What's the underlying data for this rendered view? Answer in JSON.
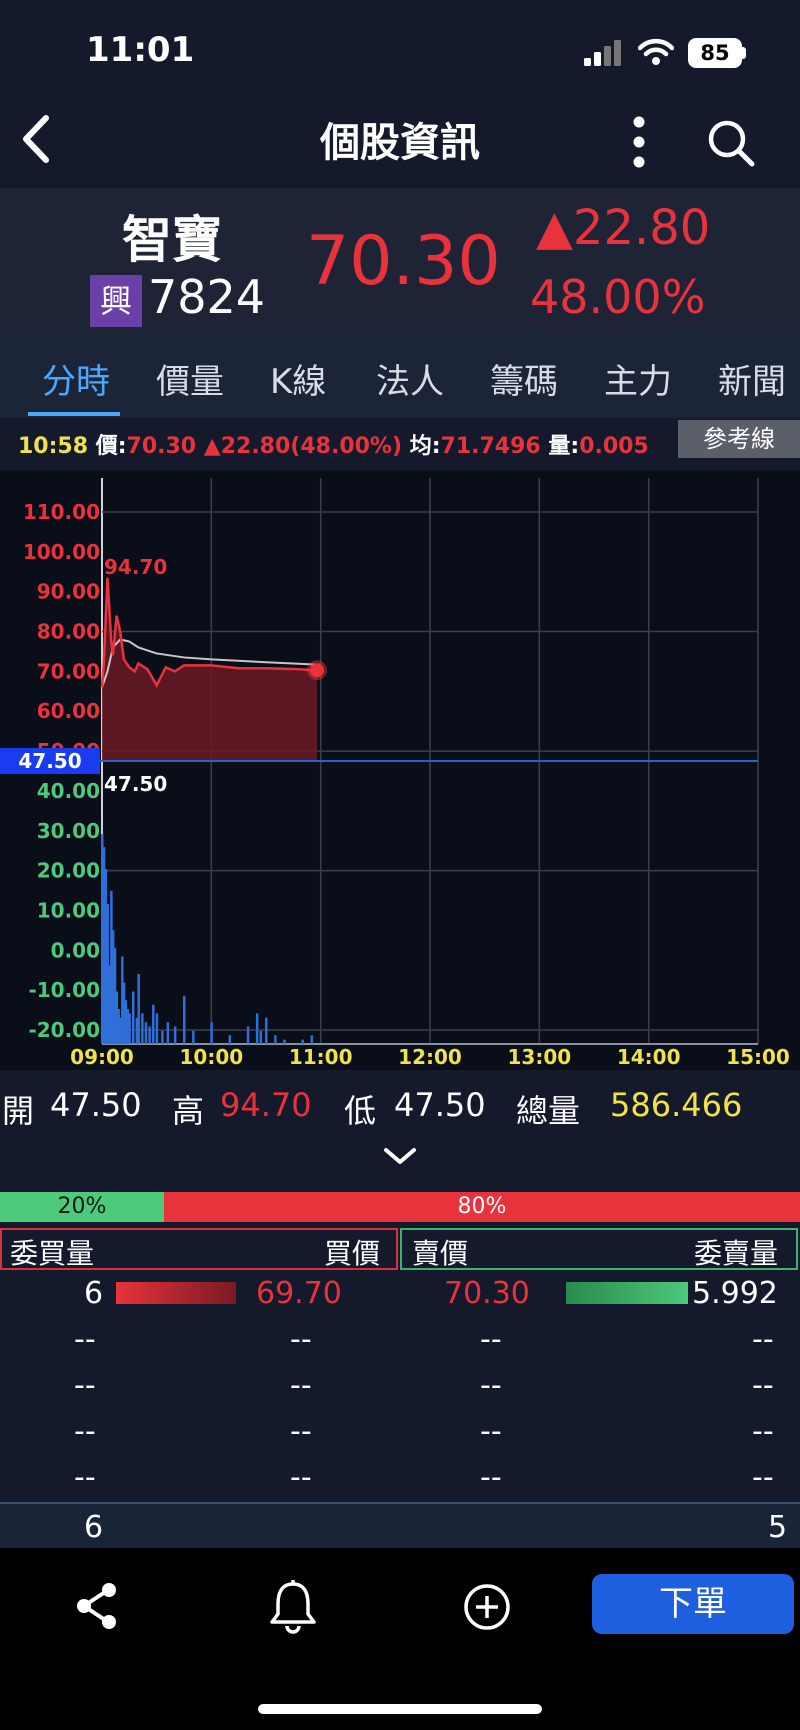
{
  "status_bar": {
    "time": "11:01",
    "battery": "85"
  },
  "header": {
    "title": "個股資訊"
  },
  "stock": {
    "name": "智寶",
    "industry_badge": "興",
    "code": "7824",
    "price": "70.30",
    "change": "▲22.80",
    "change_percent": "48.00%"
  },
  "tabs": [
    "分時",
    "價量",
    "K線",
    "法人",
    "籌碼",
    "主力",
    "新聞"
  ],
  "info": {
    "time": "10:58",
    "price_label": "價:",
    "price": "70.30",
    "change": "▲22.80(48.00%)",
    "avg_label": "均:",
    "avg": "71.7496",
    "vol_label": "量:",
    "vol": "0.005",
    "ref_line_button": "參考線"
  },
  "colors": {
    "up": "#e8323c",
    "down": "#4cc97a",
    "accent": "#4aa8ff",
    "volume": "#2f6fd8",
    "reference": "#2a5fd0"
  },
  "chart_data": {
    "type": "line",
    "price_axis_ticks": [
      "110.00",
      "100.00",
      "90.00",
      "80.00",
      "70.00",
      "60.00",
      "50.00",
      "40.00",
      "30.00",
      "20.00",
      "10.00",
      "0.00",
      "-10.00",
      "-20.00"
    ],
    "x_ticks": [
      "09:00",
      "10:00",
      "11:00",
      "12:00",
      "13:00",
      "14:00",
      "15:00"
    ],
    "reference_price": "47.50",
    "high_label": "94.70",
    "low_label": "47.50",
    "ylim": [
      -20,
      110
    ],
    "grid": true,
    "series": [
      {
        "kind": "price",
        "x": [
          "09:00",
          "09:01",
          "09:03",
          "09:05",
          "09:06",
          "09:08",
          "09:10",
          "09:12",
          "09:15",
          "09:18",
          "09:20",
          "09:25",
          "09:30",
          "09:35",
          "09:40",
          "09:45",
          "09:50",
          "10:00",
          "10:15",
          "10:30",
          "10:45",
          "10:58"
        ],
        "values": [
          66,
          72,
          93.5,
          78,
          74,
          84,
          80,
          73,
          71,
          70,
          72,
          70.5,
          66.5,
          71,
          70,
          71.5,
          71.5,
          71.5,
          70.8,
          70.8,
          70.6,
          70.3
        ]
      },
      {
        "kind": "average",
        "x": [
          "09:00",
          "09:03",
          "09:06",
          "09:10",
          "09:15",
          "09:20",
          "09:30",
          "09:45",
          "10:00",
          "10:30",
          "10:58"
        ],
        "values": [
          66,
          70,
          76,
          78,
          77.5,
          76,
          74.5,
          73.5,
          73,
          72.3,
          71.7
        ]
      }
    ],
    "volume": {
      "x": [
        "09:00",
        "09:01",
        "09:02",
        "09:03",
        "09:04",
        "09:05",
        "09:06",
        "09:07",
        "09:08",
        "09:09",
        "09:10",
        "09:11",
        "09:12",
        "09:13",
        "09:14",
        "09:15",
        "09:17",
        "09:19",
        "09:20",
        "09:22",
        "09:24",
        "09:26",
        "09:28",
        "09:30",
        "09:33",
        "09:36",
        "09:40",
        "09:45",
        "09:50",
        "10:00",
        "10:10",
        "10:20",
        "10:25",
        "10:27",
        "10:30",
        "10:35",
        "10:40",
        "10:50",
        "10:55"
      ],
      "values": [
        48,
        45,
        40,
        32,
        18,
        35,
        26,
        22,
        12,
        8,
        6,
        20,
        14,
        10,
        8,
        7,
        12,
        6,
        16,
        7,
        5,
        4,
        9,
        7,
        3,
        5,
        4,
        11,
        3,
        5,
        2,
        4,
        7,
        3,
        6,
        2,
        1,
        1,
        2
      ]
    }
  },
  "ohlc": {
    "open_label": "開",
    "open": "47.50",
    "high_label": "高",
    "high": "94.70",
    "low_label": "低",
    "low": "47.50",
    "vol_label": "總量",
    "vol": "586.466"
  },
  "order_book": {
    "buy_ratio": "20%",
    "sell_ratio": "80%",
    "buy_ratio_value": 0.2,
    "headers": {
      "bid_vol": "委買量",
      "bid_price": "買價",
      "ask_price": "賣價",
      "ask_vol": "委賣量"
    },
    "rows": [
      {
        "bid_vol": "6",
        "bid_price": "69.70",
        "ask_price": "70.30",
        "ask_vol": "5.992"
      },
      {
        "bid_vol": "--",
        "bid_price": "--",
        "ask_price": "--",
        "ask_vol": "--"
      },
      {
        "bid_vol": "--",
        "bid_price": "--",
        "ask_price": "--",
        "ask_vol": "--"
      },
      {
        "bid_vol": "--",
        "bid_price": "--",
        "ask_price": "--",
        "ask_vol": "--"
      },
      {
        "bid_vol": "--",
        "bid_price": "--",
        "ask_price": "--",
        "ask_vol": "--"
      }
    ],
    "total_bid": "6",
    "total_ask": "5"
  },
  "toolbar": {
    "order_label": "下單"
  }
}
